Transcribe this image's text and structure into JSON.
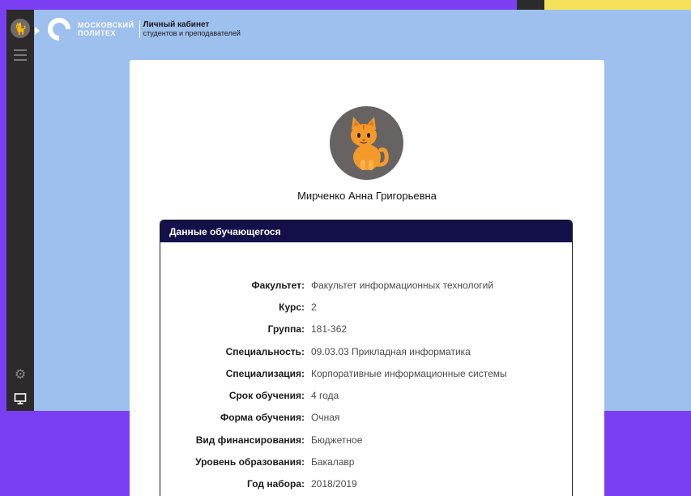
{
  "logo": {
    "brand_line1": "МОСКОВСКИЙ",
    "brand_line2": "ПОЛИТЕХ",
    "title": "Личный кабинет",
    "subtitle": "студентов и преподавателей"
  },
  "icons": {
    "avatar": "cat-emoji",
    "menu": "hamburger-icon",
    "settings": "gear-icon",
    "display": "monitor-icon"
  },
  "profile": {
    "name": "Мирченко Анна Григорьевна",
    "avatar_emoji": "🐈"
  },
  "panel": {
    "title": "Данные обучающегося",
    "rows": [
      {
        "key": "Факультет:",
        "value": "Факультет информационных технологий"
      },
      {
        "key": "Курс:",
        "value": "2"
      },
      {
        "key": "Группа:",
        "value": "181-362"
      },
      {
        "key": "Специальность:",
        "value": "09.03.03  Прикладная информатика"
      },
      {
        "key": "Специализация:",
        "value": "Корпоративные информационные системы"
      },
      {
        "key": "Срок обучения:",
        "value": "4 года"
      },
      {
        "key": "Форма обучения:",
        "value": "Очная"
      },
      {
        "key": "Вид финансирования:",
        "value": "Бюджетное"
      },
      {
        "key": "Уровень образования:",
        "value": "Бакалавр"
      },
      {
        "key": "Год набора:",
        "value": "2018/2019"
      }
    ]
  },
  "colors": {
    "page_bg": "#7a3ff2",
    "app_bg": "#9ec0ee",
    "sidebar": "#2c2a2a",
    "panel_header": "#14104a",
    "accent_yellow": "#f6e25a"
  }
}
